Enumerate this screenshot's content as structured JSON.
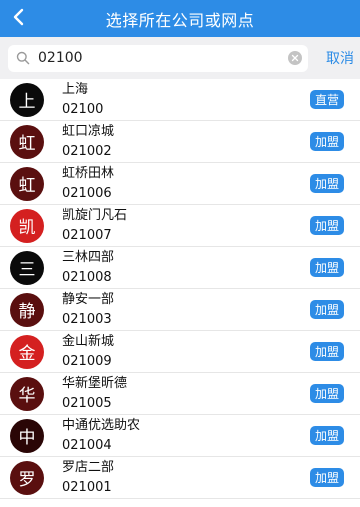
{
  "header": {
    "title": "选择所在公司或网点",
    "back_icon": "chevron-left-icon",
    "background_color": "#2d8ce6"
  },
  "search": {
    "value": "02100",
    "placeholder": "",
    "search_icon": "search-icon",
    "clear_icon": "clear-icon",
    "cancel_label": "取消"
  },
  "colors": {
    "accent": "#2d8ce6",
    "avatar_dark_red": "#5a0f0f",
    "avatar_black": "#0a0a0a",
    "avatar_red": "#d42020"
  },
  "companies": [
    {
      "avatar_char": "上",
      "avatar_color": "#0a0a0a",
      "name": "上海",
      "code": "02100",
      "tag": "直营"
    },
    {
      "avatar_char": "虹",
      "avatar_color": "#5a0f0f",
      "name": "虹口凉城",
      "code": "021002",
      "tag": "加盟"
    },
    {
      "avatar_char": "虹",
      "avatar_color": "#5a0f0f",
      "name": "虹桥田林",
      "code": "021006",
      "tag": "加盟"
    },
    {
      "avatar_char": "凯",
      "avatar_color": "#d42020",
      "name": "凯旋门凡石",
      "code": "021007",
      "tag": "加盟"
    },
    {
      "avatar_char": "三",
      "avatar_color": "#0a0a0a",
      "name": "三林四部",
      "code": "021008",
      "tag": "加盟"
    },
    {
      "avatar_char": "静",
      "avatar_color": "#5a0f0f",
      "name": "静安一部",
      "code": "021003",
      "tag": "加盟"
    },
    {
      "avatar_char": "金",
      "avatar_color": "#d42020",
      "name": "金山新城",
      "code": "021009",
      "tag": "加盟"
    },
    {
      "avatar_char": "华",
      "avatar_color": "#5a0f0f",
      "name": "华新堡昕德",
      "code": "021005",
      "tag": "加盟"
    },
    {
      "avatar_char": "中",
      "avatar_color": "#2a0606",
      "name": "中通优选助农",
      "code": "021004",
      "tag": "加盟"
    },
    {
      "avatar_char": "罗",
      "avatar_color": "#5a0f0f",
      "name": "罗店二部",
      "code": "021001",
      "tag": "加盟"
    }
  ]
}
